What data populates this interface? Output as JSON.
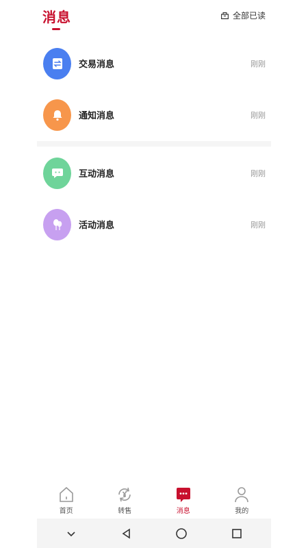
{
  "header": {
    "title": "消息",
    "read_all_label": "全部已读"
  },
  "group1": [
    {
      "label": "交易消息",
      "time": "刚刚",
      "icon": "swap-icon",
      "color": "#4a7ff0"
    },
    {
      "label": "通知消息",
      "time": "刚刚",
      "icon": "bell-icon",
      "color": "#f7964b"
    }
  ],
  "group2": [
    {
      "label": "互动消息",
      "time": "刚刚",
      "icon": "chat-bubble-icon",
      "color": "#6fd49a"
    },
    {
      "label": "活动消息",
      "time": "刚刚",
      "icon": "balloon-icon",
      "color": "#c7a0f0"
    }
  ],
  "tabbar": [
    {
      "label": "首页",
      "icon": "home-icon",
      "active": false
    },
    {
      "label": "转售",
      "icon": "resale-yen-icon",
      "active": false
    },
    {
      "label": "消息",
      "icon": "message-icon",
      "active": true
    },
    {
      "label": "我的",
      "icon": "profile-icon",
      "active": false
    }
  ],
  "colors": {
    "accent": "#c8102e",
    "divider": "#f5f5f5"
  }
}
